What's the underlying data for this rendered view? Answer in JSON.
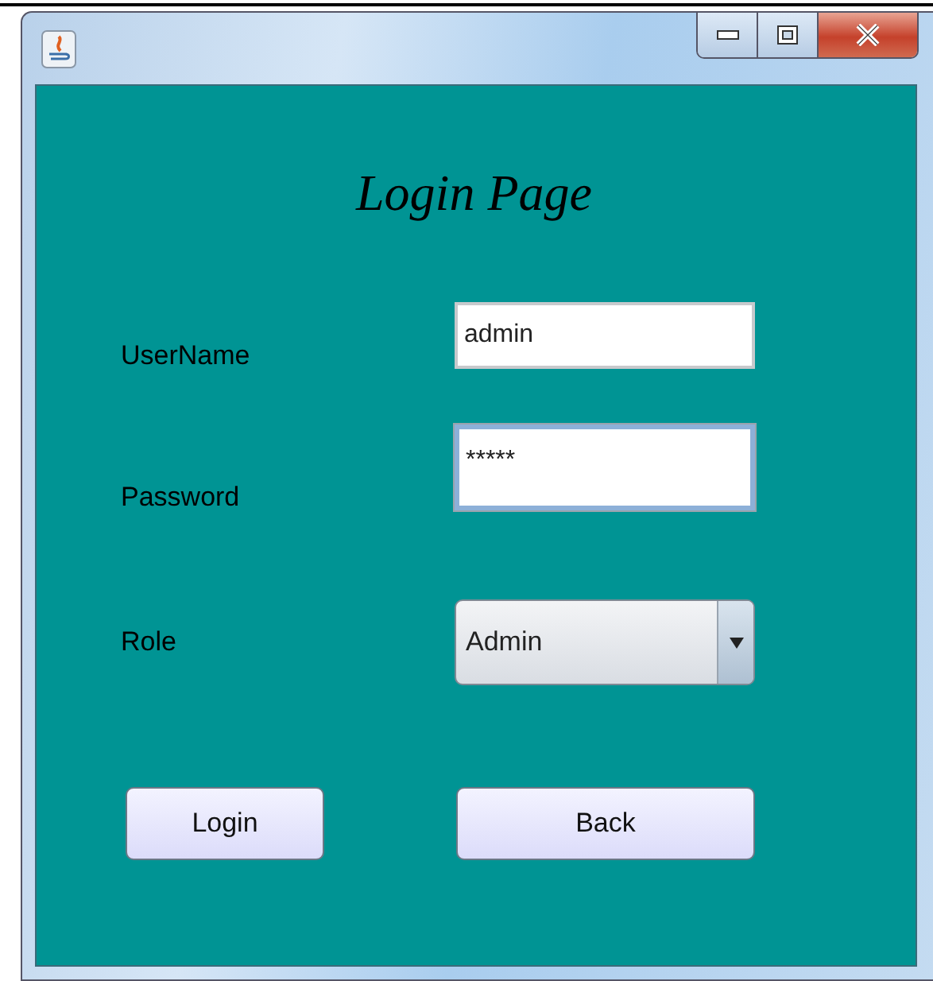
{
  "heading": "Login Page",
  "fields": [
    {
      "kind": "text",
      "label": "UserName",
      "value": "admin",
      "focused": false
    },
    {
      "kind": "password",
      "label": "Password",
      "value": "*****",
      "focused": true
    },
    {
      "kind": "combo",
      "label": "Role",
      "value": "Admin"
    }
  ],
  "buttons": [
    "Login",
    "Back"
  ]
}
